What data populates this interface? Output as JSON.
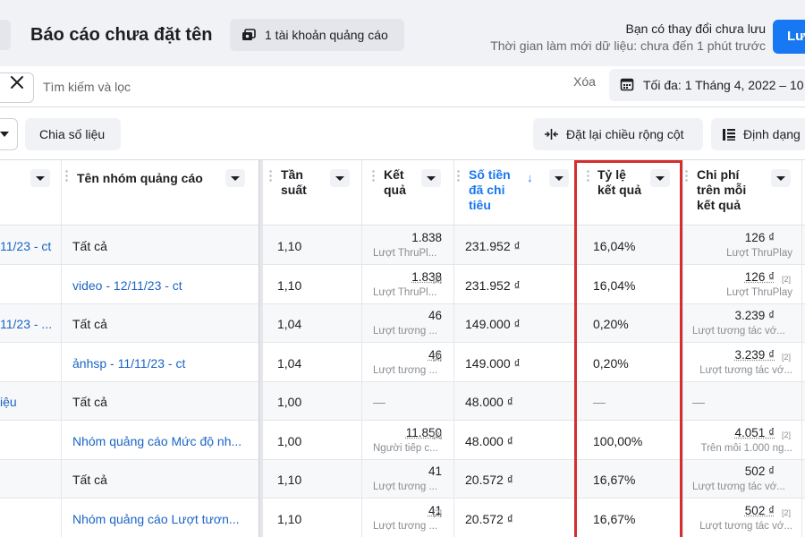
{
  "header": {
    "report_title": "Báo cáo chưa đặt tên",
    "account_button": "1 tài khoản quảng cáo",
    "unsaved_title": "Bạn có thay đổi chưa lưu",
    "refresh_text": "Thời gian làm mới dữ liệu: chưa đến 1 phút trước",
    "save_label": "Lưu"
  },
  "search": {
    "placeholder": "Tìm kiếm và lọc",
    "clear_label": "Xóa",
    "date_label": "Tối đa: 1 Tháng 4, 2022 – 10"
  },
  "toolbar": {
    "breakdown_label": "Chia số liệu",
    "reset_width_label": "Đặt lại chiều rộng cột",
    "format_label": "Định dạng"
  },
  "columns": {
    "adset_name": "Tên nhóm quảng cáo",
    "frequency": "Tần\nsuất",
    "results": "Kết\nquả",
    "amount_spent": "Số tiền\nđã chi\ntiêu",
    "result_rate": "Tỷ lệ\nkết quả",
    "cost_per_result": "Chi phí\ntrên mỗi\nkết quả"
  },
  "rows": [
    {
      "campaign": "11/23 - ct",
      "adset": "Tất cả",
      "adset_link": false,
      "frequency": "1,10",
      "results": "1.838",
      "results_sub": "Lượt ThruPl...",
      "results_badge": "",
      "amount": "231.952 ₫",
      "rate": "16,04%",
      "cost": "126 ₫",
      "cost_sub": "Lượt ThruPlay",
      "cost_badge": ""
    },
    {
      "campaign": "",
      "adset": "video - 12/11/23 - ct",
      "adset_link": true,
      "frequency": "1,10",
      "results": "1.838",
      "results_sub": "Lượt ThruPl...",
      "results_badge": "[2]",
      "amount": "231.952 ₫",
      "rate": "16,04%",
      "cost": "126 ₫",
      "cost_sub": "Lượt ThruPlay",
      "cost_badge": "[2]"
    },
    {
      "campaign": "11/23 - ...",
      "adset": "Tất cả",
      "adset_link": false,
      "frequency": "1,04",
      "results": "46",
      "results_sub": "Lượt tương ...",
      "results_badge": "",
      "amount": "149.000 ₫",
      "rate": "0,20%",
      "cost": "3.239 ₫",
      "cost_sub": "Lượt tương tác vớ...",
      "cost_badge": ""
    },
    {
      "campaign": "",
      "adset": "ảnhsp - 11/11/23 - ct",
      "adset_link": true,
      "frequency": "1,04",
      "results": "46",
      "results_sub": "Lượt tương ...",
      "results_badge": "[2]",
      "amount": "149.000 ₫",
      "rate": "0,20%",
      "cost": "3.239 ₫",
      "cost_sub": "Lượt tương tác vớ...",
      "cost_badge": "[2]"
    },
    {
      "campaign": "iệu",
      "adset": "Tất cả",
      "adset_link": false,
      "frequency": "1,00",
      "results": "—",
      "results_sub": "",
      "results_badge": "",
      "amount": "48.000 ₫",
      "rate": "—",
      "cost": "—",
      "cost_sub": "",
      "cost_badge": ""
    },
    {
      "campaign": "",
      "adset": "Nhóm quảng cáo Mức độ nh...",
      "adset_link": true,
      "frequency": "1,00",
      "results": "11.850",
      "results_sub": "Người tiếp c...",
      "results_badge": "[2]",
      "amount": "48.000 ₫",
      "rate": "100,00%",
      "cost": "4.051 ₫",
      "cost_sub": "Trên mỗi 1.000 ng...",
      "cost_badge": "[2]"
    },
    {
      "campaign": "",
      "adset": "Tất cả",
      "adset_link": false,
      "frequency": "1,10",
      "results": "41",
      "results_sub": "Lượt tương ...",
      "results_badge": "",
      "amount": "20.572 ₫",
      "rate": "16,67%",
      "cost": "502 ₫",
      "cost_sub": "Lượt tương tác vớ...",
      "cost_badge": ""
    },
    {
      "campaign": "",
      "adset": "Nhóm quảng cáo Lượt tươn...",
      "adset_link": true,
      "frequency": "1,10",
      "results": "41",
      "results_sub": "Lượt tương ...",
      "results_badge": "[2]",
      "amount": "20.572 ₫",
      "rate": "16,67%",
      "cost": "502 ₫",
      "cost_sub": "Lượt tương tác vớ...",
      "cost_badge": "[2]"
    }
  ],
  "colors": {
    "accent": "#1877f2",
    "link": "#1a64c6",
    "highlight_box": "#d32f2f"
  }
}
